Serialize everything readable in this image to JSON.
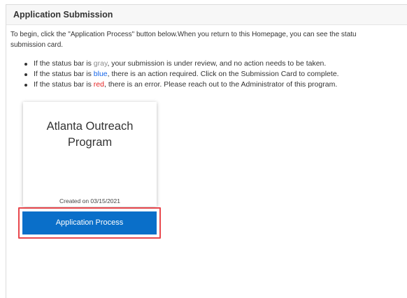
{
  "panel": {
    "title": "Application Submission"
  },
  "intro": {
    "line1": "To begin, click the \"Application Process\" button below.When you return to this Homepage, you can see the statu",
    "line2": "submission card."
  },
  "bullets": [
    {
      "prefix": "If the status bar is ",
      "color_word": "gray",
      "suffix": ", your submission is under review, and no action needs to be taken.",
      "color": "#8c8c8c"
    },
    {
      "prefix": "If the status bar is ",
      "color_word": "blue",
      "suffix": ", there is an action required. Click on the Submission Card to complete.",
      "color": "#1565e8"
    },
    {
      "prefix": "If the status bar is ",
      "color_word": "red",
      "suffix": ", there is an error. Please reach out to the Administrator of this program.",
      "color": "#e52222"
    }
  ],
  "card": {
    "title": "Atlanta Outreach\nProgram",
    "created": "Created on 03/15/2021",
    "button_label": "Application Process",
    "button_color": "#0a6fc9",
    "highlight_color": "#e8474d"
  }
}
